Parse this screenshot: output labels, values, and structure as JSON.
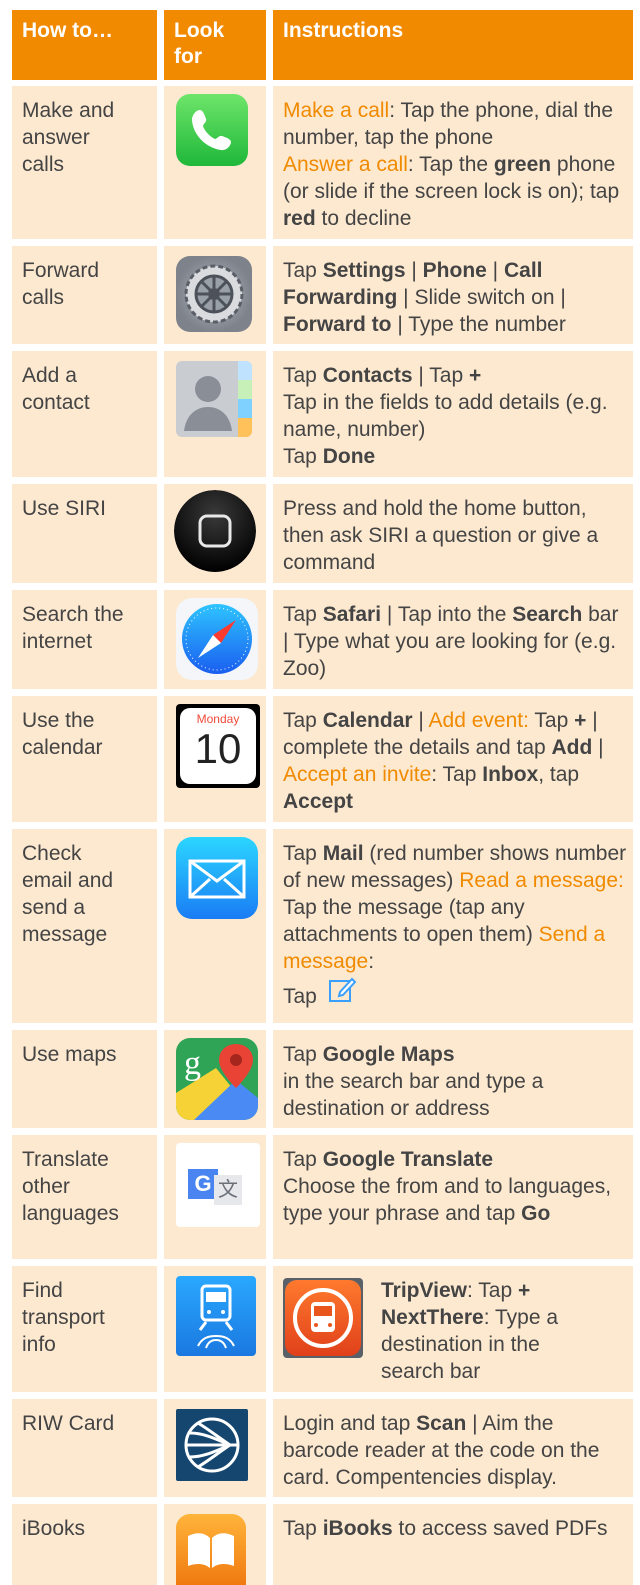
{
  "header": {
    "col1": "How to…",
    "col2a": "Look",
    "col2b": "for",
    "col3": "Instructions"
  },
  "rows": [
    {
      "task": [
        "Make and",
        "answer",
        "calls"
      ],
      "make_lbl": "Make a call",
      "make_txt": ": Tap the phone, dial the number, tap the phone",
      "ans_lbl": "Answer a call",
      "ans_1": ": Tap the ",
      "green": "green",
      "ans_2": " phone (or slide if the screen lock is on); tap ",
      "red": "red",
      "ans_3": " to decline",
      "icon": "phone-app-icon"
    },
    {
      "task": [
        "Forward",
        "calls"
      ],
      "t1": "Tap ",
      "b1": "Settings",
      "s1": " | ",
      "b2": "Phone",
      "s2": " | ",
      "b3": "Call Forwarding",
      "t2": " | Slide switch on | ",
      "b4": "Forward to",
      "t3": " | Type the number",
      "icon": "settings-app-icon"
    },
    {
      "task": [
        "Add a",
        "contact"
      ],
      "t1": "Tap ",
      "b1": "Contacts",
      "t2": " | Tap ",
      "b2": "+",
      "l2": "Tap in the fields to add details (e.g. name, number)",
      "t3": "Tap ",
      "b3": "Done",
      "icon": "contacts-app-icon"
    },
    {
      "task": [
        "Use SIRI"
      ],
      "t1": "Press and hold the home button, then ask SIRI a question or give a command",
      "icon": "home-button-icon"
    },
    {
      "task": [
        "Search the",
        "internet"
      ],
      "t1": "Tap ",
      "b1": "Safari",
      "t2": " | Tap into the ",
      "b2": "Search",
      "t3": " bar | Type what you are looking for (e.g. Zoo)",
      "icon": "safari-app-icon"
    },
    {
      "task": [
        "Use the",
        "calendar"
      ],
      "t1": "Tap ",
      "b1": "Calendar",
      "t2": " | ",
      "h1": "Add event:",
      "t3": " Tap ",
      "b2": "+",
      "t4": " | complete the details and tap ",
      "b3": "Add",
      "t5": " | ",
      "h2": "Accept an invite",
      "t6": ": Tap ",
      "b4": "Inbox",
      "t7": ", tap ",
      "b5": "Accept",
      "icon": "calendar-app-icon",
      "cal_day": "Monday",
      "cal_num": "10"
    },
    {
      "task": [
        "Check",
        "email and",
        "send a",
        "message"
      ],
      "t1": "Tap ",
      "b1": "Mail",
      "t2": " (red number shows number of new messages) ",
      "h1": "Read a message:",
      "t3": " Tap the message (tap any attachments to open them) ",
      "h2": "Send a message",
      "t4": ":",
      "t5": "Tap",
      "icon": "mail-app-icon",
      "compose_icon": "compose-icon"
    },
    {
      "task": [
        "Use maps"
      ],
      "t1": "Tap ",
      "b1": "Google Maps",
      "l2": "in the search bar and type a destination or address",
      "icon": "google-maps-icon"
    },
    {
      "task": [
        "Translate",
        "other",
        "languages"
      ],
      "t1": "Tap ",
      "b1": "Google Translate",
      "l2": "Choose the from and to languages, type your phrase and tap ",
      "b2": "Go",
      "icon": "google-translate-icon",
      "g_letter": "G",
      "zh_char": "文"
    },
    {
      "task": [
        "Find",
        "transport",
        "info"
      ],
      "b1": "TripView",
      "t1": ": Tap ",
      "b2": "+",
      "b3": "NextThere",
      "t2": ": Type a destination in the",
      "t3": "search bar",
      "icon": "tripview-icon",
      "icon2": "nextthere-icon"
    },
    {
      "task": [
        "RIW Card"
      ],
      "t1": "Login and tap ",
      "b1": "Scan",
      "t2": " | Aim the barcode reader at the code on the card. Compentencies display.",
      "icon": "riw-card-icon"
    },
    {
      "task": [
        "iBooks"
      ],
      "t1": "Tap ",
      "b1": "iBooks",
      "t2": " to access saved PDFs",
      "icon": "ibooks-icon"
    }
  ],
  "colors": {
    "header": "#f28a00",
    "cell": "#fde9d0",
    "highlight": "#f08a00"
  }
}
